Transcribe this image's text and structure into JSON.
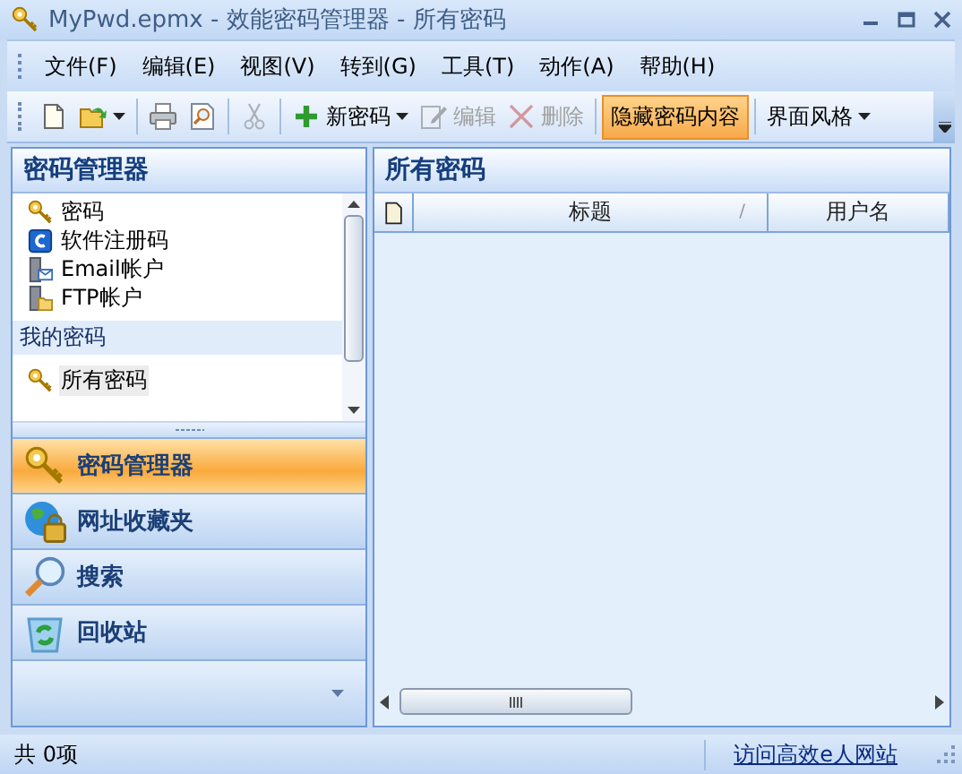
{
  "window": {
    "title": "MyPwd.epmx - 效能密码管理器 - 所有密码"
  },
  "menu": [
    "文件(F)",
    "编辑(E)",
    "视图(V)",
    "转到(G)",
    "工具(T)",
    "动作(A)",
    "帮助(H)"
  ],
  "toolbar": [
    {
      "kind": "new",
      "disabled": false
    },
    {
      "kind": "open",
      "disabled": false,
      "dropdown": true
    },
    {
      "kind": "separator"
    },
    {
      "kind": "print",
      "disabled": false
    },
    {
      "kind": "preview",
      "disabled": false
    },
    {
      "kind": "separator"
    },
    {
      "kind": "cut",
      "disabled": true
    },
    {
      "kind": "separator"
    },
    {
      "kind": "add",
      "label": "新密码",
      "disabled": false,
      "dropdown": true
    },
    {
      "kind": "edit",
      "label": "编辑",
      "disabled": true
    },
    {
      "kind": "delete",
      "label": "删除",
      "disabled": true
    },
    {
      "kind": "separator"
    },
    {
      "kind": "toggle",
      "label": "隐藏密码内容",
      "on": true
    },
    {
      "kind": "separator"
    },
    {
      "kind": "menu",
      "label": "界面风格",
      "dropdown": true
    }
  ],
  "navpane": {
    "title": "密码管理器",
    "categories": [
      {
        "label": "密码",
        "kind": "key",
        "selected": false
      },
      {
        "label": "软件注册码",
        "kind": "card",
        "selected": false
      },
      {
        "label": "Email帐户",
        "kind": "email",
        "selected": false
      },
      {
        "label": "FTP帐户",
        "kind": "ftp",
        "selected": false
      }
    ],
    "group": "我的密码",
    "folders": [
      {
        "label": "所有密码",
        "kind": "key",
        "selected": true
      }
    ],
    "buttons": [
      {
        "label": "密码管理器",
        "kind": "key",
        "selected": true
      },
      {
        "label": "网址收藏夹",
        "kind": "globe",
        "selected": false
      },
      {
        "label": "搜索",
        "kind": "search",
        "selected": false
      },
      {
        "label": "回收站",
        "kind": "recycle",
        "selected": false
      }
    ]
  },
  "list": {
    "title": "所有密码",
    "columns": [
      {
        "kind": "icon"
      },
      {
        "kind": "text",
        "label": "标题",
        "sort_indicator": "/"
      },
      {
        "kind": "text",
        "label": "用户名"
      }
    ]
  },
  "status_bar": {
    "count": "共 0项",
    "link": "访问高效e人网站"
  }
}
